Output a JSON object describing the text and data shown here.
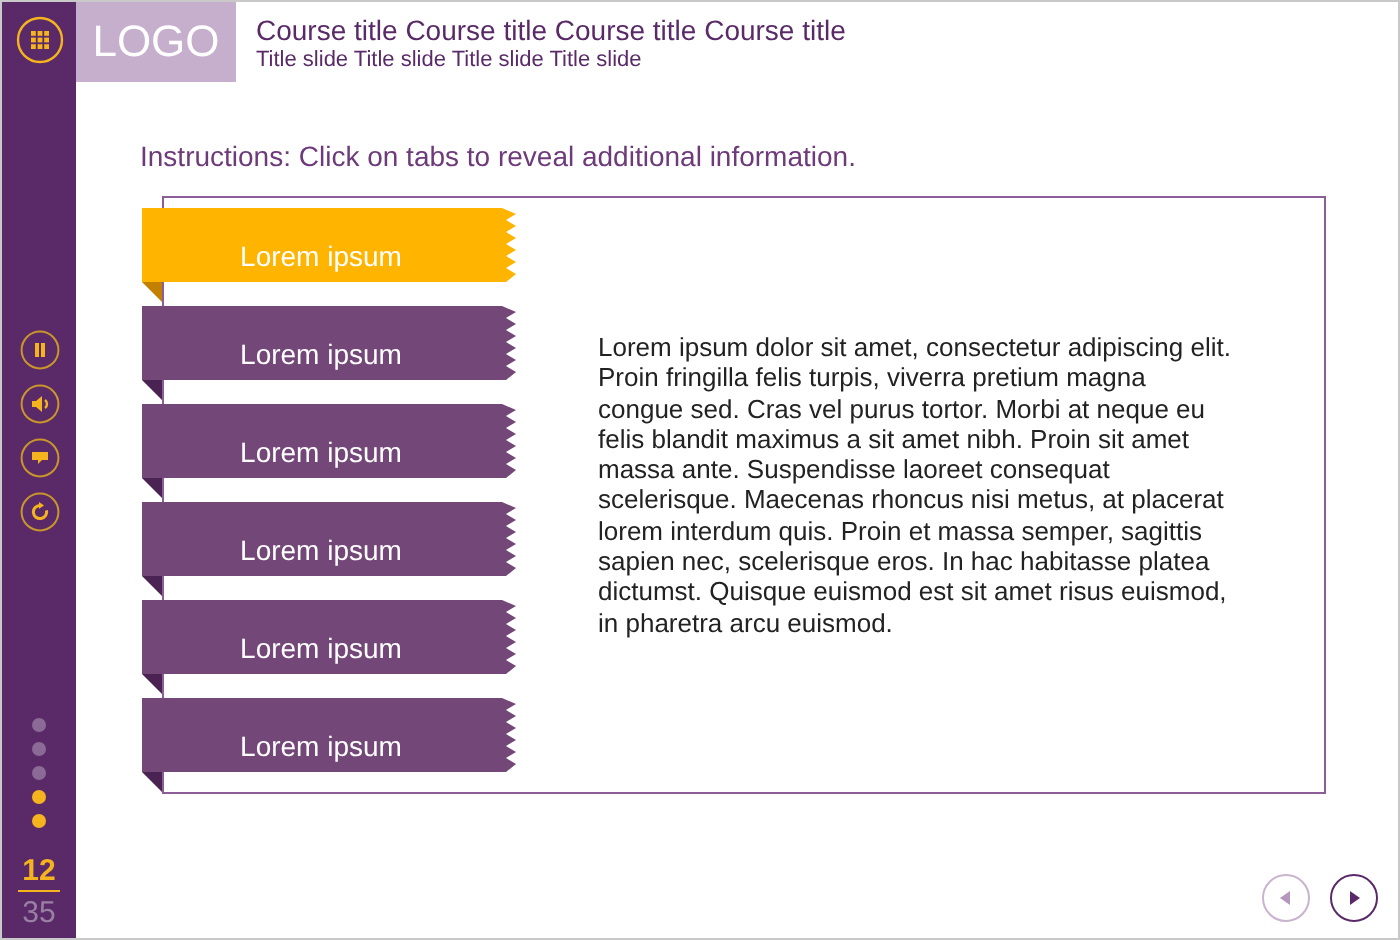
{
  "sidebar": {
    "controls": [
      {
        "kind": "pause"
      },
      {
        "kind": "audio"
      },
      {
        "kind": "captions"
      },
      {
        "kind": "replay"
      }
    ],
    "progress_dots": [
      {
        "active": false
      },
      {
        "active": false
      },
      {
        "active": false
      },
      {
        "active": true
      },
      {
        "active": true
      }
    ],
    "current_page": "12",
    "total_pages": "35"
  },
  "header": {
    "logo": "LOGO",
    "course_title": "Course title Course title Course title Course title",
    "slide_title": "Title slide Title slide Title slide Title slide"
  },
  "instructions": "Instructions: Click on tabs to reveal additional information.",
  "tabs": [
    {
      "label": "Lorem ipsum",
      "selected": true
    },
    {
      "label": "Lorem ipsum",
      "selected": false
    },
    {
      "label": "Lorem ipsum",
      "selected": false
    },
    {
      "label": "Lorem ipsum",
      "selected": false
    },
    {
      "label": "Lorem ipsum",
      "selected": false
    },
    {
      "label": "Lorem ipsum",
      "selected": false
    }
  ],
  "content": "Lorem ipsum dolor sit amet, consectetur adipiscing elit. Proin fringilla felis turpis, viverra pretium magna congue sed. Cras vel purus tortor. Morbi at neque eu felis blandit maximus a sit amet nibh. Proin sit amet massa ante. Suspendisse laoreet consequat scelerisque. Maecenas rhoncus nisi metus, at placerat lorem interdum quis. Proin et massa semper, sagittis sapien nec, scelerisque eros. In hac habitasse platea dictumst. Quisque euismod est sit amet risus euismod, in pharetra arcu euismod.",
  "navigation": {
    "previous": {
      "disabled": true
    },
    "next": {
      "disabled": false
    }
  }
}
